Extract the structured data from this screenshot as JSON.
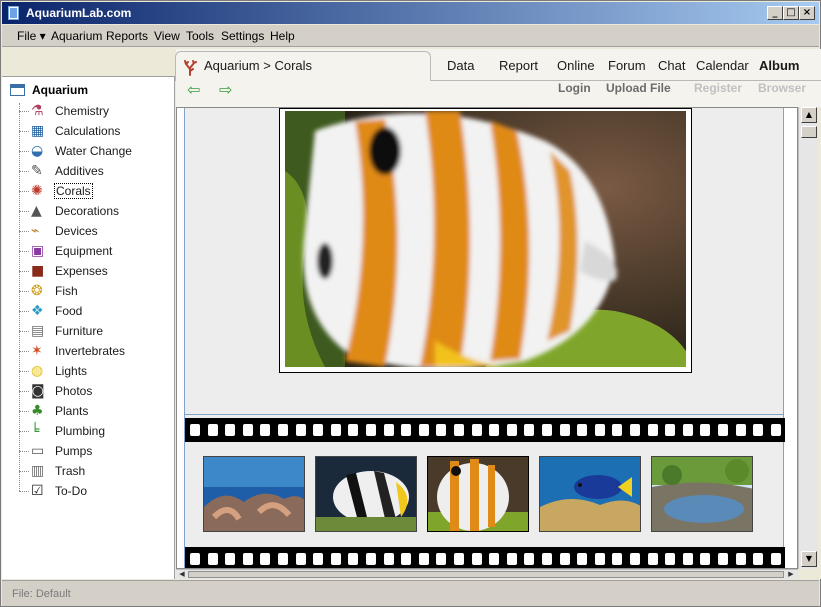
{
  "window": {
    "title": "AquariumLab.com"
  },
  "menu": {
    "items": [
      "File ▾",
      "Aquarium",
      "Reports",
      "View",
      "Tools",
      "Settings",
      "Help"
    ]
  },
  "tree": {
    "root": "Aquarium",
    "items": [
      {
        "label": "Chemistry",
        "icon": "flask-icon"
      },
      {
        "label": "Calculations",
        "icon": "calculator-icon"
      },
      {
        "label": "Water Change",
        "icon": "water-bucket-icon"
      },
      {
        "label": "Additives",
        "icon": "syringe-icon"
      },
      {
        "label": "Corals",
        "icon": "coral-icon",
        "selected": true
      },
      {
        "label": "Decorations",
        "icon": "rock-icon"
      },
      {
        "label": "Devices",
        "icon": "device-icon"
      },
      {
        "label": "Equipment",
        "icon": "equipment-icon"
      },
      {
        "label": "Expenses",
        "icon": "wallet-icon"
      },
      {
        "label": "Fish",
        "icon": "fish-icon"
      },
      {
        "label": "Food",
        "icon": "food-icon"
      },
      {
        "label": "Furniture",
        "icon": "cabinet-icon"
      },
      {
        "label": "Invertebrates",
        "icon": "starfish-icon"
      },
      {
        "label": "Lights",
        "icon": "bulb-icon"
      },
      {
        "label": "Photos",
        "icon": "camera-icon"
      },
      {
        "label": "Plants",
        "icon": "plant-icon"
      },
      {
        "label": "Plumbing",
        "icon": "pipe-icon"
      },
      {
        "label": "Pumps",
        "icon": "pump-icon"
      },
      {
        "label": "Trash",
        "icon": "trash-icon"
      },
      {
        "label": "To-Do",
        "icon": "checklist-icon"
      }
    ]
  },
  "breadcrumb": {
    "text": "Aquarium > Corals",
    "icon": "coral-icon"
  },
  "nav_tabs": [
    {
      "label": "Data"
    },
    {
      "label": "Report"
    },
    {
      "label": "Online"
    },
    {
      "label": "Forum"
    },
    {
      "label": "Chat"
    },
    {
      "label": "Calendar"
    },
    {
      "label": "Album",
      "active": true
    }
  ],
  "toolbar": {
    "back_icon": "back-arrow-icon",
    "forward_icon": "forward-arrow-icon",
    "links": [
      {
        "label": "Login",
        "enabled": true
      },
      {
        "label": "Upload File",
        "enabled": true
      },
      {
        "label": "Register",
        "enabled": false
      },
      {
        "label": "Browser",
        "enabled": false
      }
    ]
  },
  "album": {
    "selected_thumbnail": 3,
    "thumbnails": [
      "reef-tank-photo",
      "butterflyfish-photo",
      "striped-fish-photo",
      "blue-tang-photo",
      "garden-pond-photo"
    ]
  },
  "status": {
    "text": "File: Default"
  },
  "colors": {
    "title_start": "#0a246a",
    "title_end": "#a6caf0",
    "accent_arrow": "#3a9e3a",
    "disabled_link": "#c0c0c0"
  }
}
